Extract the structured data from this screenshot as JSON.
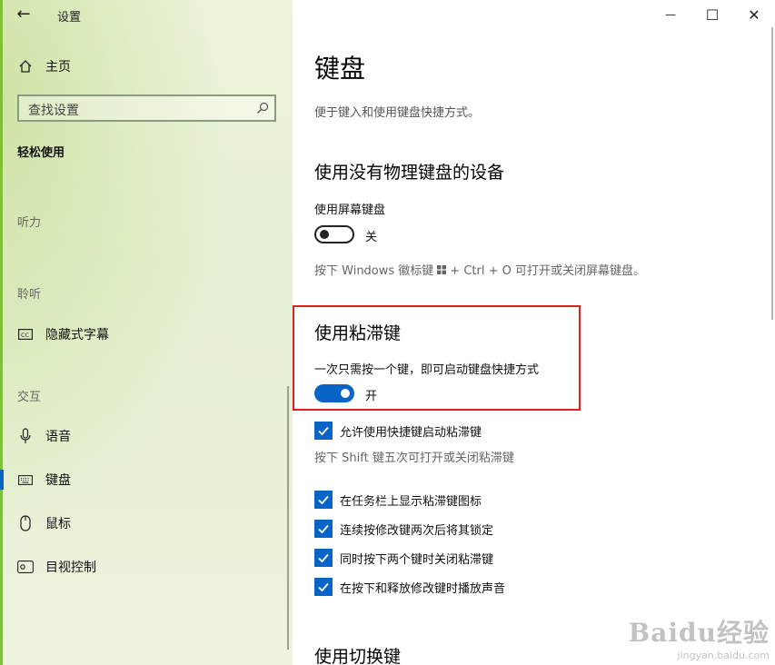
{
  "window": {
    "title": "设置",
    "minimize": "—",
    "maximize": "☐",
    "close": "✕"
  },
  "sidebar": {
    "home": "主页",
    "search_placeholder": "查找设置",
    "category": "轻松使用",
    "sections": {
      "hearing_vision": "听力",
      "listening": "聆听",
      "interaction": "交互"
    },
    "items": [
      {
        "label": "隐藏式字幕",
        "icon": "closed-caption-icon"
      },
      {
        "label": "语音",
        "icon": "microphone-icon"
      },
      {
        "label": "键盘",
        "icon": "keyboard-icon",
        "selected": true
      },
      {
        "label": "鼠标",
        "icon": "mouse-icon"
      },
      {
        "label": "目视控制",
        "icon": "eye-control-icon"
      }
    ]
  },
  "main": {
    "title": "键盘",
    "description": "便于键入和使用键盘快捷方式。",
    "onscreen": {
      "heading": "使用没有物理键盘的设备",
      "label": "使用屏幕键盘",
      "state": "关",
      "hint_before": "按下 Windows 徽标键",
      "hint_after": "+ Ctrl + O 可打开或关闭屏幕键盘。"
    },
    "sticky": {
      "heading": "使用粘滞键",
      "label": "一次只需按一个键，即可启动键盘快捷方式",
      "state": "开",
      "shortcut_option": "允许使用快捷键启动粘滞键",
      "shortcut_hint": "按下 Shift 键五次可打开或关闭粘滞键",
      "options": [
        "在任务栏上显示粘滞键图标",
        "连续按修改键两次后将其锁定",
        "同时按下两个键时关闭粘滞键",
        "在按下和释放修改键时播放声音"
      ]
    },
    "toggle_keys": {
      "heading": "使用切换键"
    }
  },
  "watermark": {
    "logo": "Baidu经验",
    "url": "jingyan.baidu.com"
  },
  "colors": {
    "accent": "#0a64c8",
    "highlight_border": "#e02020"
  }
}
